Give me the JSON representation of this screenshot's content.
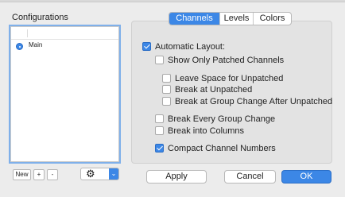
{
  "configurations": {
    "title": "Configurations",
    "items": [
      {
        "label": "Main",
        "selected": true
      }
    ],
    "buttons": {
      "new_label": "New",
      "add_label": "+",
      "remove_label": "-"
    }
  },
  "tabs": [
    {
      "label": "Channels",
      "active": true
    },
    {
      "label": "Levels",
      "active": false
    },
    {
      "label": "Colors",
      "active": false
    }
  ],
  "options": {
    "automatic_layout": {
      "label": "Automatic Layout:",
      "checked": true
    },
    "show_only_patched": {
      "label": "Show Only Patched Channels",
      "checked": false
    },
    "leave_space": {
      "label": "Leave Space for Unpatched",
      "checked": false
    },
    "break_unpatched": {
      "label": "Break at Unpatched",
      "checked": false
    },
    "break_group_change_after": {
      "label": "Break at Group Change After Unpatched",
      "checked": false
    },
    "break_every_group": {
      "label": "Break Every Group Change",
      "checked": false
    },
    "break_columns": {
      "label": "Break into Columns",
      "checked": false
    },
    "compact_numbers": {
      "label": "Compact Channel Numbers",
      "checked": true
    }
  },
  "footer": {
    "apply_label": "Apply",
    "cancel_label": "Cancel",
    "ok_label": "OK"
  },
  "colors": {
    "accent": "#3c87e6",
    "focus_ring": "#7fb0ea",
    "background": "#ececec"
  }
}
